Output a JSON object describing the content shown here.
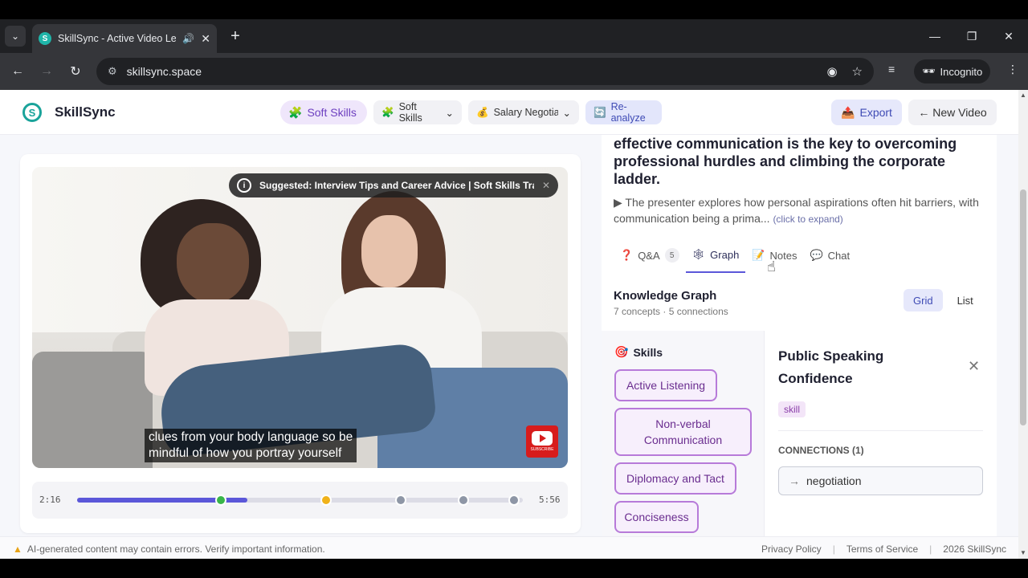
{
  "browser": {
    "tab_title": "SkillSync - Active Video Lea",
    "url": "skillsync.space",
    "incognito_label": "Incognito"
  },
  "header": {
    "logo_text": "SkillSync",
    "active_pill": "Soft Skills",
    "select1": "Soft Skills",
    "select2": "Salary Negotiati",
    "reanalyze": "Re-analyze",
    "export": "Export",
    "new_video": "← New Video"
  },
  "video": {
    "suggestion": "Suggested: Interview Tips and Career Advice | Soft Skills Traini...",
    "caption_line1": "clues from your body language so be",
    "caption_line2": "mindful of how you portray yourself",
    "subscribe_label": "SUBSCRIBE",
    "current_time": "2:16",
    "duration": "5:56",
    "progress_fraction": 0.382,
    "markers": [
      {
        "fraction": 0.322,
        "color": "#3ab54a"
      },
      {
        "fraction": 0.558,
        "color": "#f0b21a"
      },
      {
        "fraction": 0.727,
        "color": "#8e96a6"
      },
      {
        "fraction": 0.867,
        "color": "#8e96a6"
      },
      {
        "fraction": 0.98,
        "color": "#8e96a6"
      }
    ]
  },
  "panel": {
    "headline": "effective communication is the key to overcoming professional hurdles and climbing the corporate ladder.",
    "summary": "▶ The presenter explores how personal aspirations often hit barriers, with communication being a prima...",
    "expand": "(click to expand)",
    "tabs": [
      {
        "label": "Q&A",
        "badge": "5",
        "icon": "question-icon"
      },
      {
        "label": "Graph",
        "icon": "graph-icon"
      },
      {
        "label": "Notes",
        "icon": "notes-icon"
      },
      {
        "label": "Chat",
        "icon": "chat-icon"
      }
    ],
    "kg_title": "Knowledge Graph",
    "kg_sub": "7 concepts · 5 connections",
    "view_grid": "Grid",
    "view_list": "List",
    "category": "Skills",
    "chips": [
      "Active Listening",
      "Non-verbal Communication",
      "Diplomacy and Tact",
      "Conciseness"
    ],
    "detail": {
      "title": "Public Speaking Confidence",
      "tag": "skill",
      "connections_heading": "CONNECTIONS (1)",
      "connection": "negotiation"
    }
  },
  "footer": {
    "warning": "AI-generated content may contain errors. Verify important information.",
    "privacy": "Privacy Policy",
    "terms": "Terms of Service",
    "copyright": "2026 SkillSync"
  },
  "colors": {
    "accent": "#5b57d9",
    "brand_teal": "#1aa39a",
    "chip_border": "#b77ad9"
  }
}
